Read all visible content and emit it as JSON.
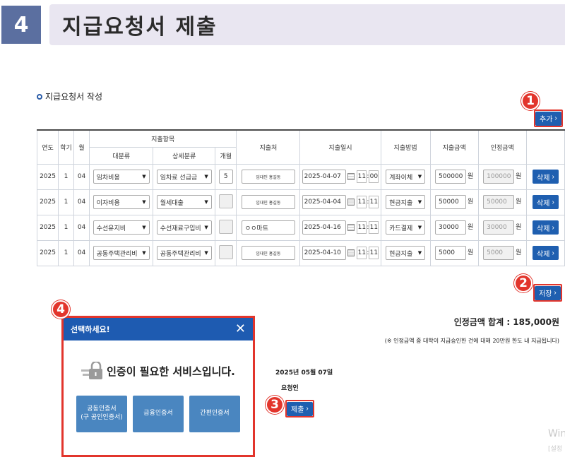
{
  "section": {
    "number": "4",
    "title": "지급요청서 제출"
  },
  "subtitle": "지급요청서 작성",
  "buttons": {
    "add": "추가",
    "save": "저장",
    "submit": "제출",
    "delete": "삭제",
    "arrow": "›"
  },
  "badges": [
    "1",
    "2",
    "3",
    "4"
  ],
  "table": {
    "headers": {
      "year": "연도",
      "semester": "학기",
      "month": "월",
      "category_group": "지출항목",
      "major": "대분류",
      "detail": "상세분류",
      "months": "개월",
      "payee": "지출처",
      "datetime": "지출일시",
      "method": "지출방법",
      "amount": "지출금액",
      "approved": "인정금액"
    },
    "won": "원",
    "rows": [
      {
        "year": "2025",
        "semester": "1",
        "month": "04",
        "major": "임차비용",
        "detail": "임차료 선급금",
        "months": "5",
        "payee": "임대인 홍길동",
        "date": "2025-04-07",
        "hour": "11",
        "minute": "00",
        "method": "계좌이체",
        "amount": "500000",
        "approved": "100000"
      },
      {
        "year": "2025",
        "semester": "1",
        "month": "04",
        "major": "이자비용",
        "detail": "월세대출",
        "months": "",
        "payee": "임대인 홍길동",
        "date": "2025-04-04",
        "hour": "11",
        "minute": "11",
        "method": "현금지출",
        "amount": "50000",
        "approved": "50000"
      },
      {
        "year": "2025",
        "semester": "1",
        "month": "04",
        "major": "수선유지비",
        "detail": "수선재료구입비",
        "months": "",
        "payee": "ㅇㅇ마트",
        "date": "2025-04-16",
        "hour": "11",
        "minute": "11",
        "method": "카드결제",
        "amount": "30000",
        "approved": "30000"
      },
      {
        "year": "2025",
        "semester": "1",
        "month": "04",
        "major": "공동주택관리비",
        "detail": "공동주택관리비",
        "months": "",
        "payee": "임대인 홍길동",
        "date": "2025-04-10",
        "hour": "11",
        "minute": "11",
        "method": "현금지출",
        "amount": "5000",
        "approved": "5000"
      }
    ]
  },
  "total": "인정금액 합계 : 185,000원",
  "note": "(※ 인정금액 중 대학이 지급승인한 건에 대해 20만원 한도 내 지급됩니다)",
  "request_date": "2025년 05월 07일",
  "applicant": "요청인",
  "popup": {
    "title": "선택하세요!",
    "close": "✕",
    "message": "인증이 필요한 서비스입니다.",
    "options": [
      "공동인증서\n(구 공인인증서)",
      "금융인증서",
      "간편인증서"
    ]
  },
  "watermark": {
    "line1": "Win",
    "line2": "[설정"
  },
  "colors": {
    "primary": "#1f5fb0",
    "highlight": "#e2352c",
    "header_bg": "#e9e6f1",
    "section_num_bg": "#5b6fa0"
  }
}
